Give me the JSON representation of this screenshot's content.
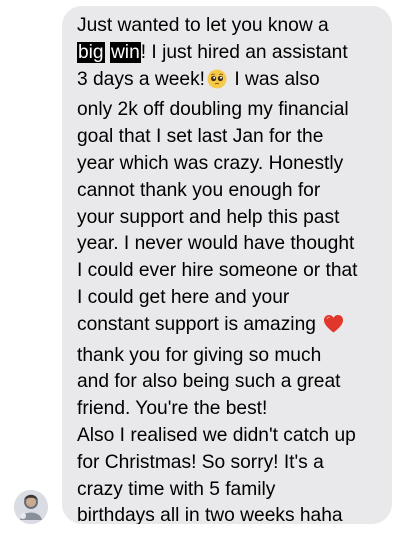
{
  "conversation": {
    "message": {
      "lines": [
        "Just wanted to let you know a",
        "big",
        "win",
        "! I just hired an assistant",
        "3 days a week!",
        "I was also",
        "only 2k off doubling my financial",
        "goal that I set last Jan for the",
        "year which was crazy. Honestly",
        "cannot thank you enough for",
        "your support and help this past",
        "year. I never would have thought",
        "I could ever hire someone or that",
        "I could get here and your",
        "constant support is amazing",
        "thank you for giving so much",
        "and for also being such a great",
        "friend. You're the best!",
        "Also I realised we didn't catch up",
        "for Christmas! So sorry! It's a",
        "crazy time with 5 family",
        "birthdays all in two weeks haha"
      ],
      "emojis": [
        "pleading-face-emoji",
        "red-heart-emoji"
      ]
    },
    "sender": {
      "avatar_icon": "profile-photo"
    },
    "colors": {
      "bubble": "#e9e9eb",
      "text": "#000000",
      "highlight_bg": "#000000",
      "highlight_text": "#ffffff"
    }
  }
}
